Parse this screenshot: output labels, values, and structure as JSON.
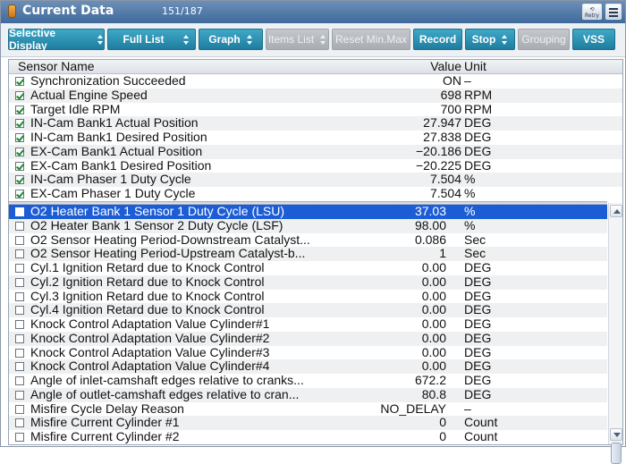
{
  "window": {
    "title": "Current Data",
    "page_count": "151/187",
    "retry_label": "Retry"
  },
  "toolbar": {
    "selective_display": "Selective Display",
    "full_list": "Full List",
    "graph": "Graph",
    "items_list": "Items List",
    "reset_min_max": "Reset Min.Max",
    "record": "Record",
    "stop": "Stop",
    "grouping": "Grouping",
    "vss": "VSS"
  },
  "table": {
    "headers": {
      "name": "Sensor Name",
      "value": "Value",
      "unit": "Unit"
    },
    "fixed_rows": [
      {
        "name": "Synchronization Succeeded",
        "value": "ON",
        "unit": "–",
        "checked": true
      },
      {
        "name": "Actual Engine Speed",
        "value": "698",
        "unit": "RPM",
        "checked": true
      },
      {
        "name": "Target Idle RPM",
        "value": "700",
        "unit": "RPM",
        "checked": true
      },
      {
        "name": "IN-Cam Bank1 Actual Position",
        "value": "27.947",
        "unit": "DEG",
        "checked": true
      },
      {
        "name": "IN-Cam Bank1 Desired Position",
        "value": "27.838",
        "unit": "DEG",
        "checked": true
      },
      {
        "name": "EX-Cam Bank1 Actual Position",
        "value": "−20.186",
        "unit": "DEG",
        "checked": true
      },
      {
        "name": "EX-Cam Bank1 Desired Position",
        "value": "−20.225",
        "unit": "DEG",
        "checked": true
      },
      {
        "name": "IN-Cam Phaser 1 Duty Cycle",
        "value": "7.504",
        "unit": "%",
        "checked": true
      },
      {
        "name": "EX-Cam Phaser 1 Duty Cycle",
        "value": "7.504",
        "unit": "%",
        "checked": true
      }
    ],
    "scroll_rows": [
      {
        "name": "O2 Heater Bank 1 Sensor 1 Duty Cycle (LSU)",
        "value": "37.03",
        "unit": "%",
        "checked": false,
        "selected": true
      },
      {
        "name": "O2 Heater Bank 1 Sensor 2 Duty Cycle (LSF)",
        "value": "98.00",
        "unit": "%",
        "checked": false
      },
      {
        "name": "O2 Sensor Heating Period-Downstream Catalyst...",
        "value": "0.086",
        "unit": "Sec",
        "checked": false
      },
      {
        "name": "O2 Sensor Heating Period-Upstream Catalyst-b...",
        "value": "1",
        "unit": "Sec",
        "checked": false
      },
      {
        "name": "Cyl.1 Ignition Retard due to Knock Control",
        "value": "0.00",
        "unit": "DEG",
        "checked": false
      },
      {
        "name": "Cyl.2 Ignition Retard due to Knock Control",
        "value": "0.00",
        "unit": "DEG",
        "checked": false
      },
      {
        "name": "Cyl.3 Ignition Retard due to Knock Control",
        "value": "0.00",
        "unit": "DEG",
        "checked": false
      },
      {
        "name": "Cyl.4 Ignition Retard due to Knock Control",
        "value": "0.00",
        "unit": "DEG",
        "checked": false
      },
      {
        "name": "Knock Control Adaptation Value Cylinder#1",
        "value": "0.00",
        "unit": "DEG",
        "checked": false
      },
      {
        "name": "Knock Control Adaptation Value Cylinder#2",
        "value": "0.00",
        "unit": "DEG",
        "checked": false
      },
      {
        "name": "Knock Control Adaptation Value Cylinder#3",
        "value": "0.00",
        "unit": "DEG",
        "checked": false
      },
      {
        "name": "Knock Control Adaptation Value Cylinder#4",
        "value": "0.00",
        "unit": "DEG",
        "checked": false
      },
      {
        "name": "Angle of inlet-camshaft edges relative to cranks...",
        "value": "672.2",
        "unit": "DEG",
        "checked": false
      },
      {
        "name": "Angle of outlet-camshaft edges relative to cran...",
        "value": "80.8",
        "unit": "DEG",
        "checked": false
      },
      {
        "name": "Misfire Cycle Delay Reason",
        "value": "NO_DELAY",
        "unit": "–",
        "checked": false
      },
      {
        "name": "Misfire Current Cylinder #1",
        "value": "0",
        "unit": "Count",
        "checked": false
      },
      {
        "name": "Misfire Current Cylinder #2",
        "value": "0",
        "unit": "Count",
        "checked": false
      }
    ]
  },
  "icons": {
    "app": "car-battery-icon",
    "retry": "retry-icon",
    "list": "list-view-icon",
    "dropdown": "updown-chevron-icon",
    "checkbox": "checkbox-icon"
  },
  "colors": {
    "title_bar": "#3f6a9b",
    "button_teal": "#1f7d9f",
    "button_disabled": "#a8adb3",
    "selection": "#1c5dd6",
    "check_green": "#1b8a2e"
  }
}
